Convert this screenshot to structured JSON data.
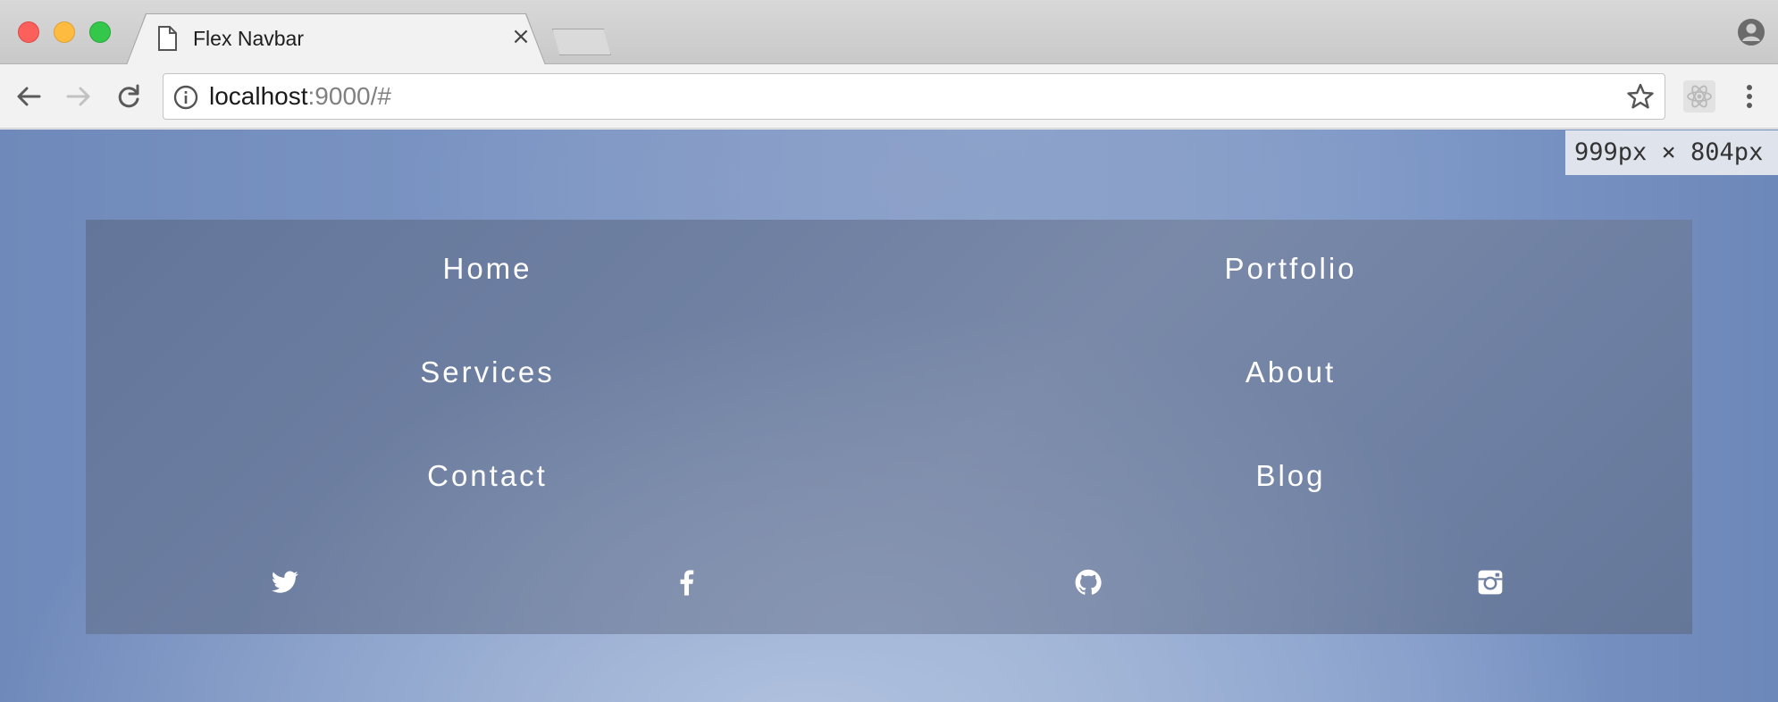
{
  "browser": {
    "tab_title": "Flex Navbar",
    "tab_close": "×",
    "url_host": "localhost",
    "url_rest": ":9000/#"
  },
  "viewport_badge": "999px × 804px",
  "navbar": {
    "links": [
      "Home",
      "Portfolio",
      "Services",
      "About",
      "Contact",
      "Blog"
    ],
    "social_icons": [
      "twitter-icon",
      "facebook-icon",
      "github-icon",
      "instagram-icon"
    ]
  },
  "colors": {
    "page_background": "#7d97c6",
    "navbar_background": "#6f80a2",
    "nav_text": "#ffffff"
  }
}
